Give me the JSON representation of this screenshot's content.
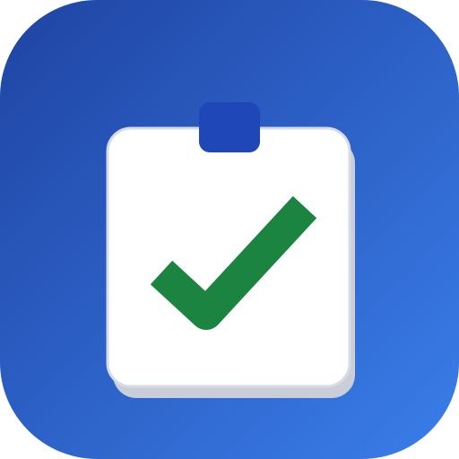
{
  "icon": {
    "name": "checklist-clipboard-icon",
    "bg_gradient_start": "#1f44a3",
    "bg_gradient_end": "#3a7eea",
    "paper_color": "#ffffff",
    "paper_border_color": "#d7dbe6",
    "paper_shadow_color": "#c9ced8",
    "clip_color": "#1f47b8",
    "check_color": "#1b8440"
  }
}
